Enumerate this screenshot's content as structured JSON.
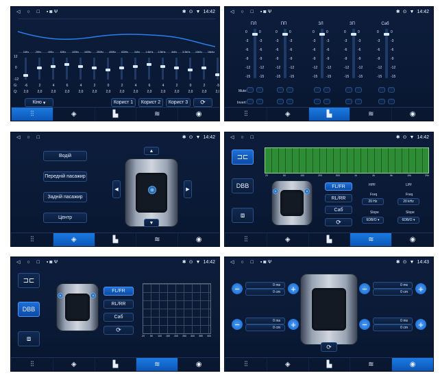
{
  "status": {
    "time_a": "14:42",
    "time_b": "14:43"
  },
  "tabs": [
    "⫶⫶",
    "◈",
    "▙",
    "≋",
    "◉"
  ],
  "eq": {
    "top_scale": [
      "12",
      "0",
      "-12"
    ],
    "bands": [
      "16Hz",
      "25Hz",
      "40Hz",
      "63Hz",
      "100Hz",
      "160Hz",
      "250Hz",
      "400Hz",
      "630Hz",
      "1kHz",
      "1.6kHz",
      "2.5kHz",
      "4kHz",
      "6.3kHz",
      "10kHz",
      "16kHz"
    ],
    "gains": [
      "-6",
      "2",
      "4",
      "6",
      "4",
      "2",
      "0",
      "2",
      "4",
      "6",
      "4",
      "2",
      "0",
      "2",
      "-5"
    ],
    "q": [
      "2,0",
      "2,0",
      "2,0",
      "2,0",
      "2,0",
      "2,0",
      "2,0",
      "2,0",
      "2,0",
      "2,0",
      "2,0",
      "2,0",
      "2,0",
      "2,0",
      "2,0"
    ],
    "g_label": "G:",
    "q_label": "Q:",
    "preset": "Кіно",
    "presets": [
      "Корист 1",
      "Корист 2",
      "Корист 3"
    ],
    "reset": "⟳"
  },
  "levels": {
    "channels": [
      "ПЛ",
      "ПП",
      "ЗЛ",
      "ЗП",
      "Саб"
    ],
    "scale": [
      "0",
      "-3",
      "-6",
      "-9",
      "-12",
      "-15"
    ],
    "mute": "Mute:",
    "invert": "Invert:"
  },
  "zone": {
    "buttons": [
      "Водій",
      "Передній пасажир",
      "Задній пасажир",
      "Центр"
    ]
  },
  "xover": {
    "modes": [
      "FL/FR",
      "RL/RR",
      "Саб"
    ],
    "hpf": "HPF",
    "lpf": "LPF",
    "freq_label": "Freq",
    "freq_hpf": "20 Hz",
    "freq_lpf": "20 kHz",
    "slope_label": "Slope",
    "slope_hpf": "6DB/O ▾",
    "slope_lpf": "6DB/O ▾",
    "axis": [
      "20",
      "50",
      "100",
      "200",
      "500",
      "1k",
      "2k",
      "5k",
      "10k",
      "20k"
    ]
  },
  "dbb": {
    "label": "DBB",
    "axis": [
      "20",
      "50",
      "100",
      "150",
      "200",
      "250",
      "300",
      "350",
      "400"
    ]
  },
  "delay": {
    "ms": "0 ms",
    "cm": "0 cm"
  }
}
